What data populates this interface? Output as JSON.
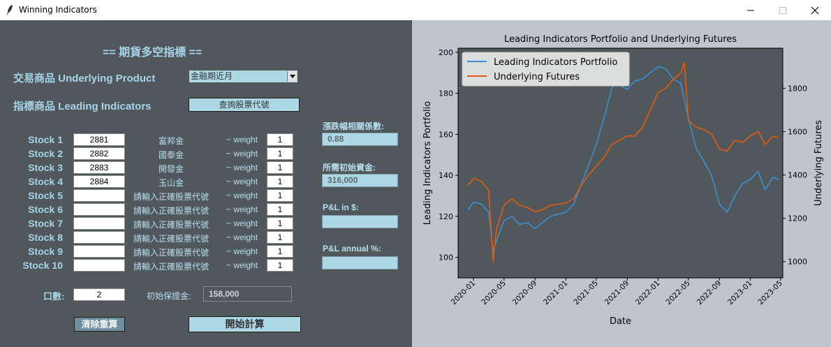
{
  "window": {
    "title": "Winning Indicators"
  },
  "form": {
    "heading": "== 期貨多空指標 ==",
    "underlying_label": "交易商品 Underlying Product",
    "underlying_value": "金融期近月",
    "indicators_label": "指標商品 Leading Indicators",
    "lookup_button": "查詢股票代號",
    "weight_label": "~ weight",
    "stocks": [
      {
        "label": "Stock 1",
        "code": "2881",
        "name": "富邦金",
        "weight": "1"
      },
      {
        "label": "Stock 2",
        "code": "2882",
        "name": "國泰金",
        "weight": "1"
      },
      {
        "label": "Stock 3",
        "code": "2883",
        "name": "開發金",
        "weight": "1"
      },
      {
        "label": "Stock 4",
        "code": "2884",
        "name": "玉山金",
        "weight": "1"
      },
      {
        "label": "Stock 5",
        "code": "",
        "name": "請輸入正確股票代號",
        "weight": "1"
      },
      {
        "label": "Stock 6",
        "code": "",
        "name": "請輸入正確股票代號",
        "weight": "1"
      },
      {
        "label": "Stock 7",
        "code": "",
        "name": "請輸入正確股票代號",
        "weight": "1"
      },
      {
        "label": "Stock 8",
        "code": "",
        "name": "請輸入正確股票代號",
        "weight": "1"
      },
      {
        "label": "Stock 9",
        "code": "",
        "name": "請輸入正確股票代號",
        "weight": "1"
      },
      {
        "label": "Stock 10",
        "code": "",
        "name": "請輸入正確股票代號",
        "weight": "1"
      }
    ],
    "correlation_label": "漲跌幅相關係數:",
    "correlation_value": "0.88",
    "capital_label": "所需初始資金:",
    "capital_value": "316,000",
    "pnl_label": "P&L in $:",
    "pnl_value": "",
    "pnl_annual_label": "P&L annual %:",
    "pnl_annual_value": "",
    "lots_label": "口數:",
    "lots_value": "2",
    "margin_label": "初始保證金:",
    "margin_value": "158,000",
    "reset_button": "清除重算",
    "start_button": "開始計算"
  },
  "chart_data": {
    "type": "line",
    "title": "Leading Indicators Portfolio and Underlying Futures",
    "xlabel": "Date",
    "ylabel": "Leading Indicators Portfolio",
    "y2label": "Underlying Futures",
    "ylim": [
      90,
      202
    ],
    "y2lim": [
      925,
      1985
    ],
    "yticks": [
      100,
      120,
      140,
      160,
      180,
      200
    ],
    "y2ticks": [
      1000,
      1200,
      1400,
      1600,
      1800
    ],
    "xlim": [
      "2019-11-01",
      "2023-05-10"
    ],
    "xticks": [
      "2020-01",
      "2020-05",
      "2020-09",
      "2021-01",
      "2021-05",
      "2021-09",
      "2022-01",
      "2022-05",
      "2022-09",
      "2023-01",
      "2023-05"
    ],
    "grid": false,
    "legend_position": "top-left",
    "series": [
      {
        "name": "Leading Indicators Portfolio",
        "axis": "left",
        "color": "#3b8fd6",
        "x": [
          "2019-12-10",
          "2020-01-01",
          "2020-02-01",
          "2020-03-01",
          "2020-03-19",
          "2020-04-01",
          "2020-05-01",
          "2020-06-01",
          "2020-07-01",
          "2020-08-01",
          "2020-09-01",
          "2020-10-01",
          "2020-11-01",
          "2020-12-01",
          "2021-01-01",
          "2021-02-01",
          "2021-03-01",
          "2021-04-01",
          "2021-05-01",
          "2021-06-01",
          "2021-07-01",
          "2021-07-20",
          "2021-08-01",
          "2021-09-01",
          "2021-10-01",
          "2021-11-01",
          "2021-12-01",
          "2022-01-01",
          "2022-02-01",
          "2022-03-01",
          "2022-04-01",
          "2022-05-01",
          "2022-06-01",
          "2022-07-01",
          "2022-08-01",
          "2022-09-01",
          "2022-10-01",
          "2022-11-01",
          "2022-12-01",
          "2023-01-01",
          "2023-02-01",
          "2023-03-01",
          "2023-04-01",
          "2023-04-25"
        ],
        "values": [
          123,
          127,
          126,
          122,
          103,
          108,
          118,
          120,
          116,
          117,
          114,
          117,
          120,
          121,
          122,
          126,
          135,
          145,
          155,
          168,
          182,
          188,
          184,
          182,
          186,
          187,
          190,
          193,
          192,
          187,
          185,
          168,
          153,
          147,
          140,
          126,
          122,
          130,
          136,
          138,
          142,
          133,
          139,
          138
        ]
      },
      {
        "name": "Underlying Futures",
        "axis": "right",
        "color": "#e8590c",
        "x": [
          "2019-12-10",
          "2020-01-01",
          "2020-02-01",
          "2020-03-01",
          "2020-03-19",
          "2020-04-01",
          "2020-05-01",
          "2020-06-01",
          "2020-07-01",
          "2020-08-01",
          "2020-09-01",
          "2020-10-01",
          "2020-11-01",
          "2020-12-01",
          "2021-01-01",
          "2021-02-01",
          "2021-03-01",
          "2021-04-01",
          "2021-05-01",
          "2021-06-01",
          "2021-07-01",
          "2021-08-01",
          "2021-09-01",
          "2021-10-01",
          "2021-11-01",
          "2021-12-01",
          "2022-01-01",
          "2022-02-01",
          "2022-03-01",
          "2022-04-01",
          "2022-04-15",
          "2022-05-01",
          "2022-06-01",
          "2022-07-01",
          "2022-08-01",
          "2022-09-01",
          "2022-10-01",
          "2022-11-01",
          "2022-12-01",
          "2023-01-01",
          "2023-02-01",
          "2023-03-01",
          "2023-04-01",
          "2023-04-25"
        ],
        "values": [
          1350,
          1385,
          1370,
          1330,
          1000,
          1150,
          1260,
          1290,
          1260,
          1250,
          1230,
          1240,
          1260,
          1265,
          1270,
          1290,
          1350,
          1400,
          1440,
          1480,
          1540,
          1560,
          1580,
          1580,
          1620,
          1700,
          1780,
          1800,
          1840,
          1870,
          1920,
          1650,
          1620,
          1610,
          1590,
          1520,
          1510,
          1560,
          1550,
          1580,
          1600,
          1540,
          1580,
          1570
        ]
      }
    ]
  }
}
